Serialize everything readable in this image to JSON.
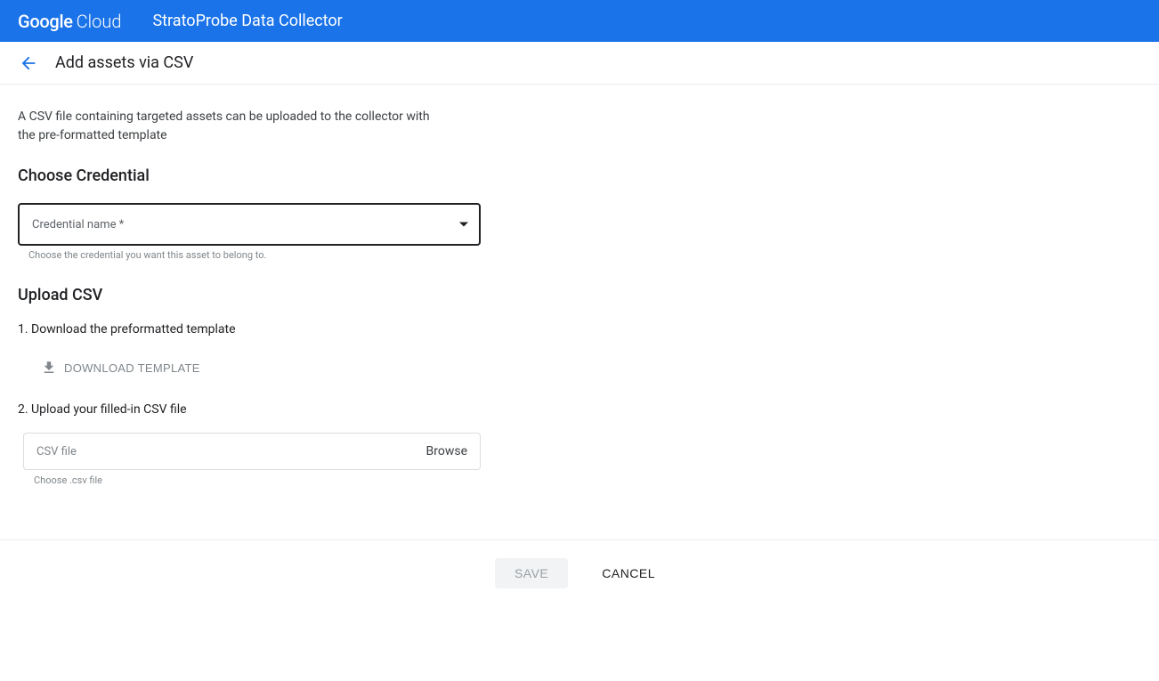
{
  "header": {
    "logo_google": "Google",
    "logo_cloud": "Cloud",
    "app_title": "StratoProbe Data Collector"
  },
  "page": {
    "title": "Add assets via CSV",
    "description": "A CSV file containing targeted assets can be uploaded to the collector with the pre-formatted template"
  },
  "credential": {
    "heading": "Choose Credential",
    "field_label": "Credential name *",
    "helper": "Choose the credential you want this asset to belong to."
  },
  "upload": {
    "heading": "Upload CSV",
    "step1": "1. Download the preformatted template",
    "download_button": "DOWNLOAD TEMPLATE",
    "step2": "2. Upload your filled-in CSV file",
    "file_placeholder": "CSV file",
    "browse": "Browse",
    "file_helper": "Choose .csv file"
  },
  "footer": {
    "save": "SAVE",
    "cancel": "CANCEL"
  }
}
